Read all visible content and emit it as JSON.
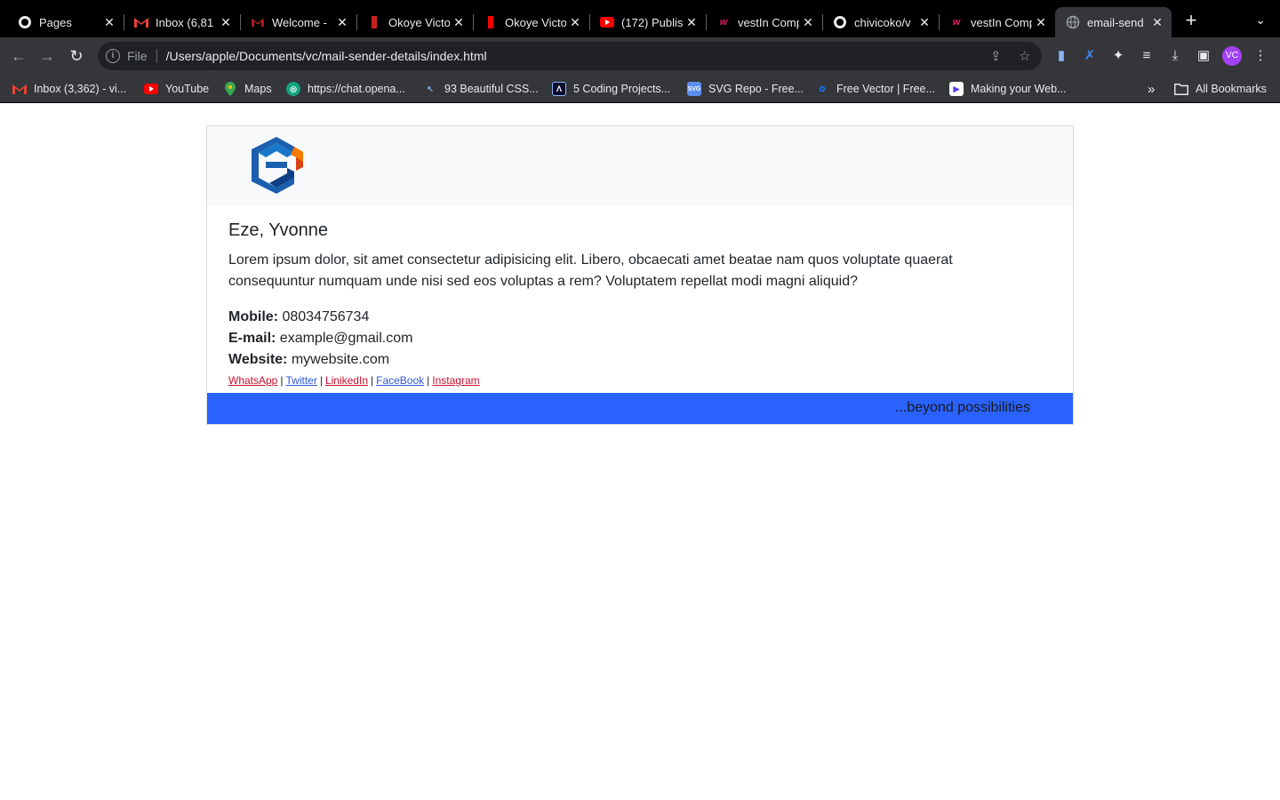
{
  "tabs": [
    {
      "title": "Pages",
      "icon": "github-icon"
    },
    {
      "title": "Inbox (6,81",
      "icon": "gmail-icon"
    },
    {
      "title": "Welcome - ",
      "icon": "gmail-icon"
    },
    {
      "title": "Okoye Victo",
      "icon": "app-icon"
    },
    {
      "title": "Okoye Victo",
      "icon": "app-icon"
    },
    {
      "title": "(172) Publis",
      "icon": "youtube-icon"
    },
    {
      "title": "vestIn Comp",
      "icon": "vestin-icon"
    },
    {
      "title": "chivicoko/v",
      "icon": "github-icon"
    },
    {
      "title": "vestIn Comp",
      "icon": "vestin-icon"
    },
    {
      "title": "email-send",
      "icon": "globe-icon"
    }
  ],
  "address_bar": {
    "scheme": "File",
    "url": "/Users/apple/Documents/vc/mail-sender-details/index.html"
  },
  "profile": {
    "initials": "VC"
  },
  "bookmarks": [
    {
      "label": "Inbox (3,362) - vi...",
      "icon": "gmail-icon"
    },
    {
      "label": "YouTube",
      "icon": "youtube-icon"
    },
    {
      "label": "Maps",
      "icon": "maps-icon"
    },
    {
      "label": "https://chat.opena...",
      "icon": "openai-icon"
    },
    {
      "label": "93 Beautiful CSS...",
      "icon": "cursor-icon"
    },
    {
      "label": "5 Coding Projects...",
      "icon": "coding-icon"
    },
    {
      "label": "SVG Repo - Free...",
      "icon": "svgrepo-icon"
    },
    {
      "label": "Free Vector | Free...",
      "icon": "freepik-icon"
    },
    {
      "label": "Making your Web...",
      "icon": "web-icon"
    }
  ],
  "bookmarks_overflow": "»",
  "all_bookmarks": "All Bookmarks",
  "card": {
    "name": "Eze, Yvonne",
    "bio": "Lorem ipsum dolor, sit amet consectetur adipisicing elit. Libero, obcaecati amet beatae nam quos voluptate quaerat consequuntur numquam unde nisi sed eos voluptas a rem? Voluptatem repellat modi magni aliquid?",
    "mobile_label": "Mobile:",
    "mobile": "08034756734",
    "email_label": "E-mail:",
    "email": "example@gmail.com",
    "website_label": "Website:",
    "website": "mywebsite.com",
    "socials": [
      "WhatsApp",
      "Twitter",
      "LinikedIn",
      "FaceBook",
      "Instagram"
    ],
    "tagline": "...beyond possibilities"
  },
  "colors": {
    "footer_blue": "#2962ff",
    "header_gray": "#f8f9fa",
    "link_red": "#c8102e",
    "link_blue": "#2f55d4"
  }
}
